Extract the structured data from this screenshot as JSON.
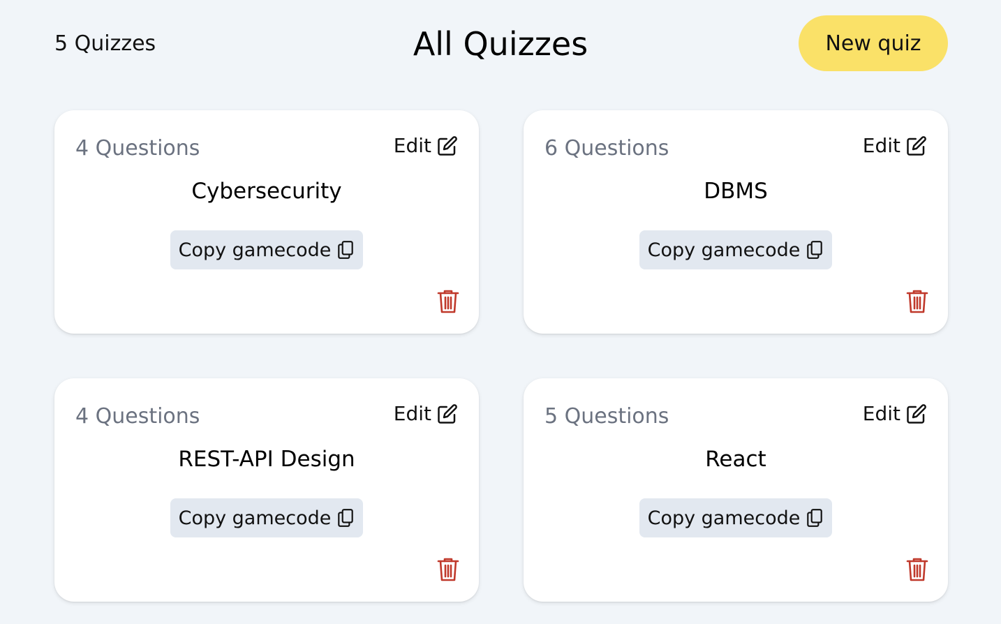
{
  "header": {
    "quiz_count": "5 Quizzes",
    "title": "All Quizzes",
    "new_quiz_label": "New quiz"
  },
  "colors": {
    "background": "#f1f5f9",
    "new_quiz_button": "#fae168",
    "copy_button": "#e2e8f0",
    "delete_icon": "#c0392b",
    "questions_text": "#6b7280"
  },
  "quizzes": [
    {
      "questions": "4 Questions",
      "title": "Cybersecurity",
      "edit_label": "Edit",
      "copy_label": "Copy gamecode"
    },
    {
      "questions": "6 Questions",
      "title": "DBMS",
      "edit_label": "Edit",
      "copy_label": "Copy gamecode"
    },
    {
      "questions": "4 Questions",
      "title": "REST-API Design",
      "edit_label": "Edit",
      "copy_label": "Copy gamecode"
    },
    {
      "questions": "5 Questions",
      "title": "React",
      "edit_label": "Edit",
      "copy_label": "Copy gamecode"
    }
  ],
  "icons": {
    "edit": "edit-icon",
    "copy": "copy-icon",
    "delete": "trash-icon"
  }
}
